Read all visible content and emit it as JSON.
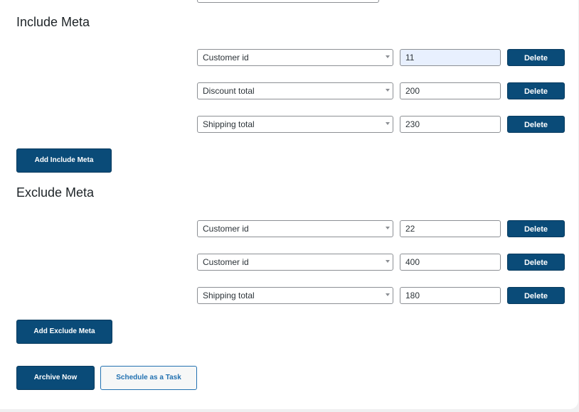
{
  "include_meta": {
    "heading": "Include Meta",
    "rows": [
      {
        "field": "Customer id",
        "value": "11",
        "delete_label": "Delete"
      },
      {
        "field": "Discount total",
        "value": "200",
        "delete_label": "Delete"
      },
      {
        "field": "Shipping total",
        "value": "230",
        "delete_label": "Delete"
      }
    ],
    "add_label": "Add Include Meta"
  },
  "exclude_meta": {
    "heading": "Exclude Meta",
    "rows": [
      {
        "field": "Customer id",
        "value": "22",
        "delete_label": "Delete"
      },
      {
        "field": "Customer id",
        "value": "400",
        "delete_label": "Delete"
      },
      {
        "field": "Shipping total",
        "value": "180",
        "delete_label": "Delete"
      }
    ],
    "add_label": "Add Exclude Meta"
  },
  "actions": {
    "archive_label": "Archive Now",
    "schedule_label": "Schedule as a Task"
  },
  "colors": {
    "primary": "#0a4b78",
    "secondary_text": "#2271b1",
    "focused_input": "#e8f0fe"
  }
}
